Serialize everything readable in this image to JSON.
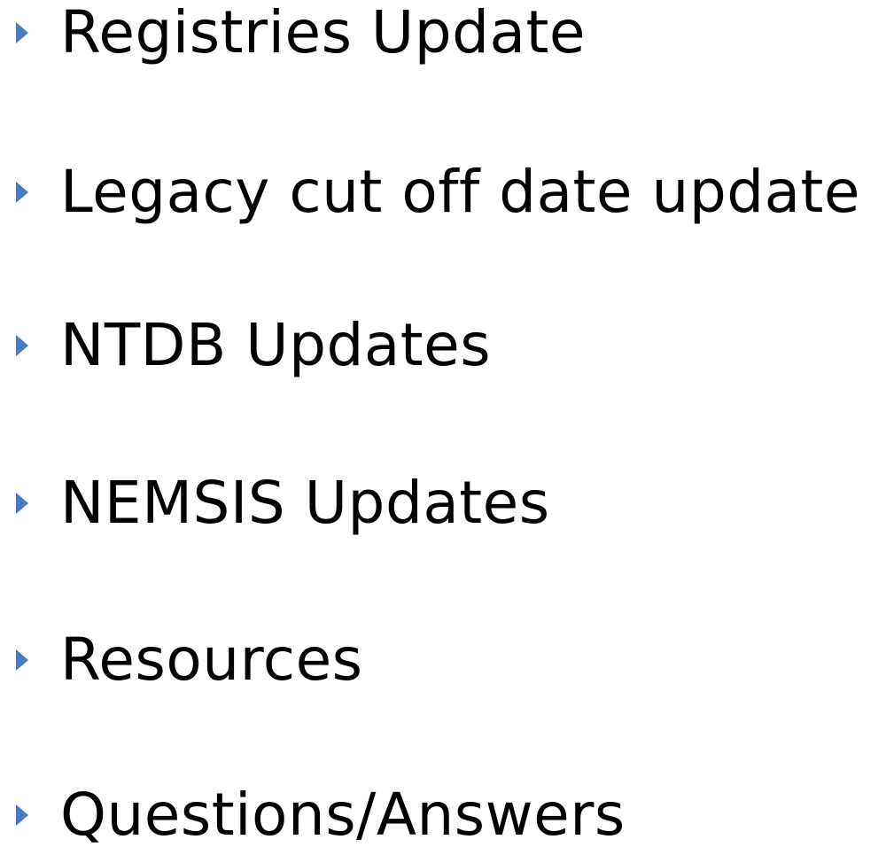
{
  "bullets": [
    {
      "label": "Registries Update"
    },
    {
      "label": "Legacy cut off date update"
    },
    {
      "label": "NTDB Updates"
    },
    {
      "label": "NEMSIS Updates"
    },
    {
      "label": "Resources"
    },
    {
      "label": "Questions/Answers"
    }
  ],
  "colors": {
    "bullet_marker": "#4a7bbf",
    "text": "#000000",
    "background": "#ffffff"
  },
  "icons": {
    "bullet_marker": "triangle-right-icon"
  }
}
